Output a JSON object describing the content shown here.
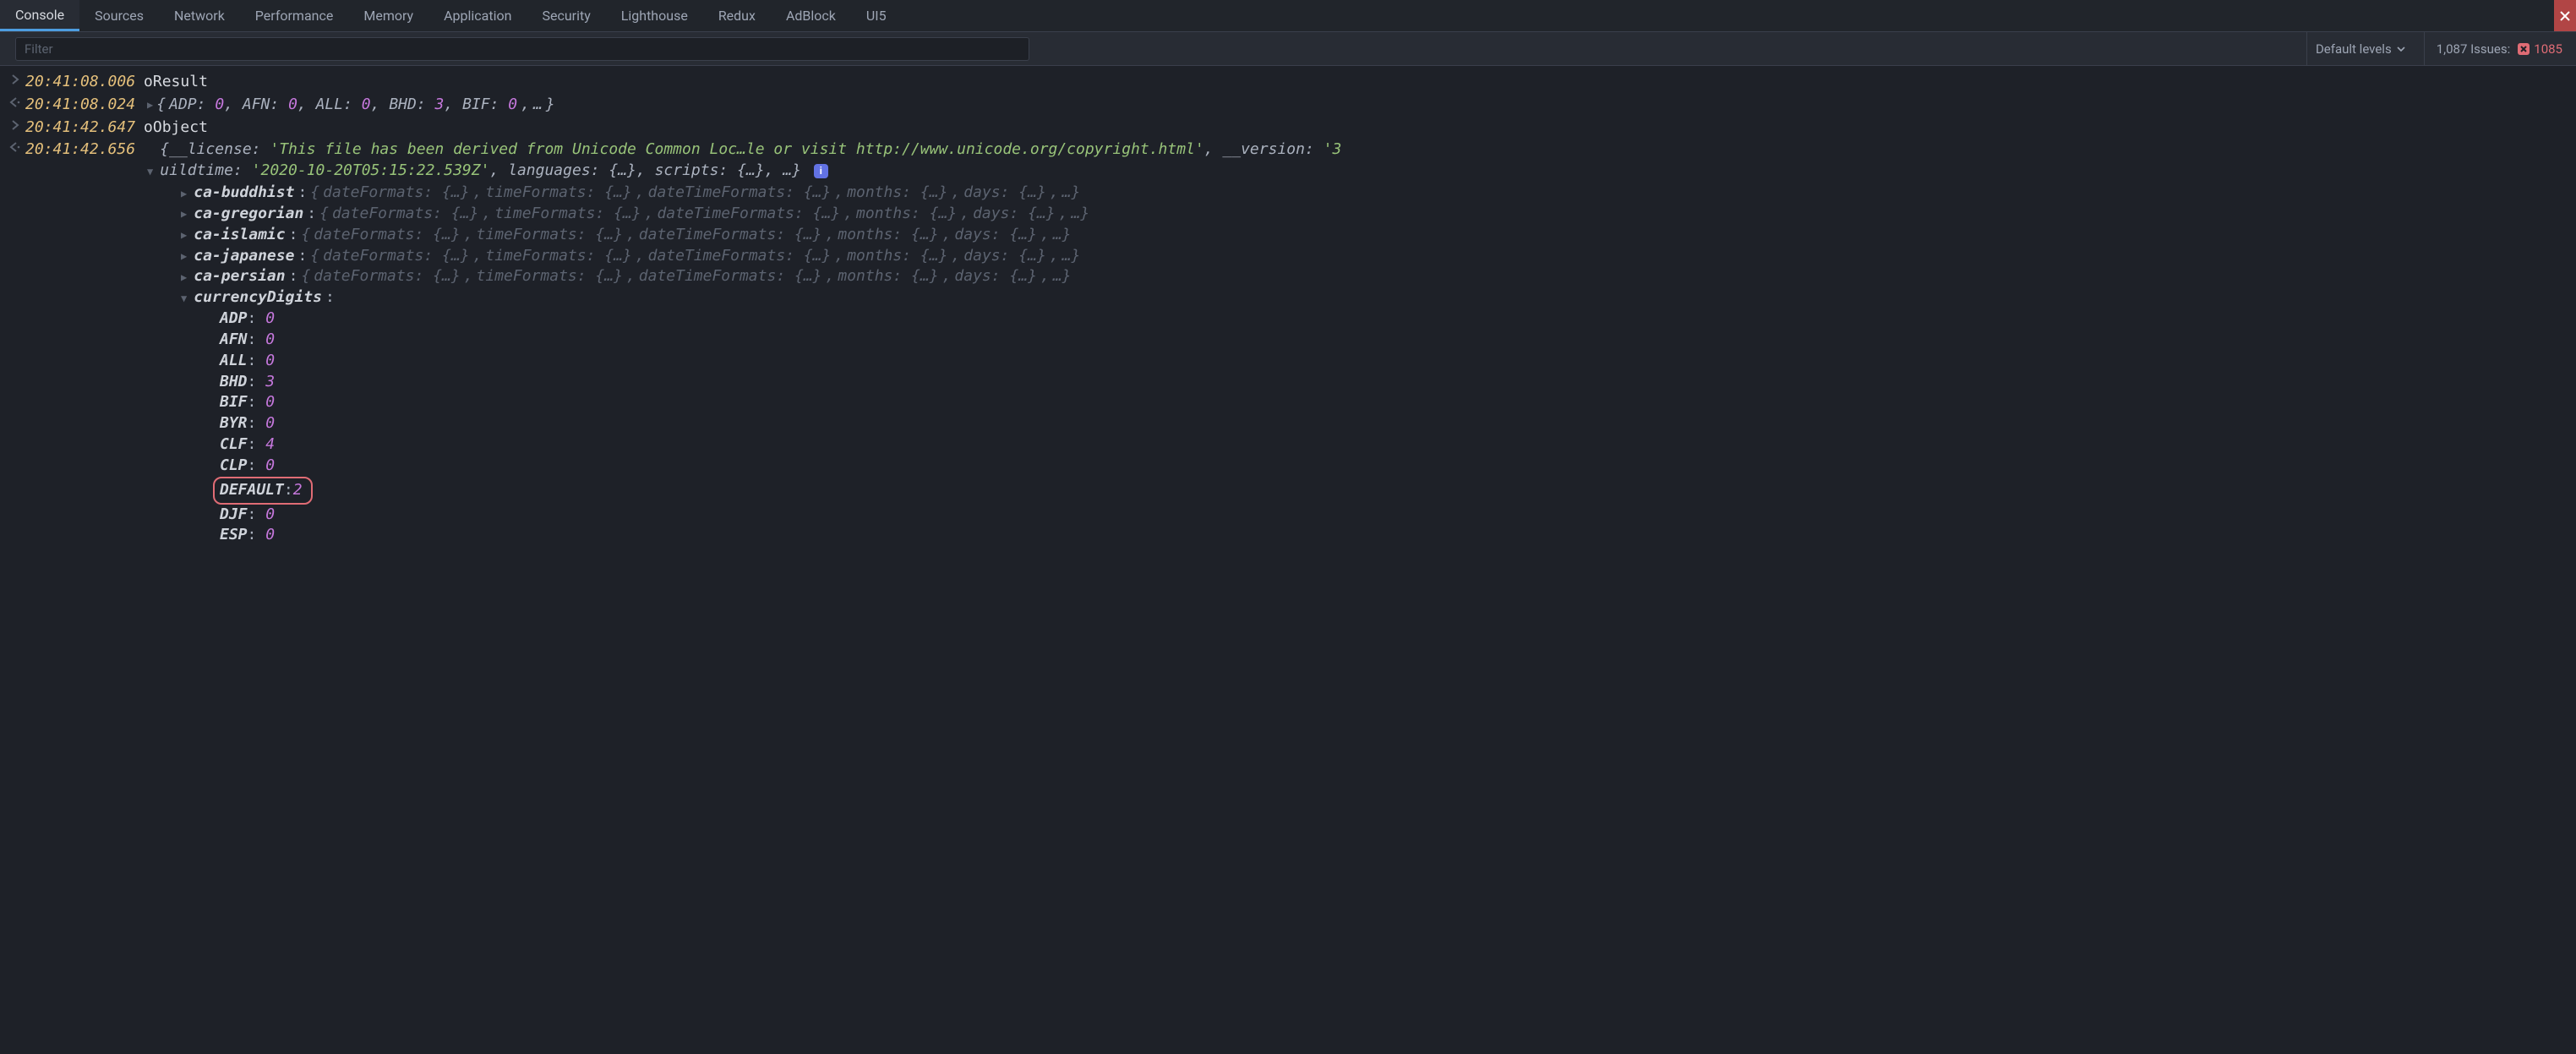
{
  "tabs": [
    "Console",
    "Sources",
    "Network",
    "Performance",
    "Memory",
    "Application",
    "Security",
    "Lighthouse",
    "Redux",
    "AdBlock",
    "UI5"
  ],
  "active_tab_index": 0,
  "filter": {
    "placeholder": "Filter"
  },
  "levels_label": "Default levels",
  "issues_label": "1,087 Issues:",
  "issues_error_count": "1085",
  "info_badge": "i",
  "rows": [
    {
      "dir": "in",
      "ts": "20:41:08.006",
      "ident": "oResult"
    },
    {
      "dir": "out",
      "ts": "20:41:08.024",
      "preview_pairs": [
        {
          "k": "ADP",
          "v": "0"
        },
        {
          "k": "AFN",
          "v": "0"
        },
        {
          "k": "ALL",
          "v": "0"
        },
        {
          "k": "BHD",
          "v": "3"
        },
        {
          "k": "BIF",
          "v": "0"
        }
      ],
      "preview_trailing": "…"
    },
    {
      "dir": "in",
      "ts": "20:41:42.647",
      "ident": "oObject"
    },
    {
      "dir": "out",
      "ts": "20:41:42.656",
      "expanded": true
    }
  ],
  "obj_preview": {
    "line1": {
      "license_key": "__license",
      "license_val": "'This file has been derived from Unicode Common Loc…le or visit http://www.unicode.org/copyright.html'",
      "version_key": "__version",
      "version_tail": "'3"
    },
    "line2": {
      "buildtime_tail_key": "uildtime",
      "buildtime_val": "'2020-10-20T05:15:22.539Z'",
      "languages_key": "languages",
      "scripts_key": "scripts"
    }
  },
  "calendars": [
    "ca-buddhist",
    "ca-gregorian",
    "ca-islamic",
    "ca-japanese",
    "ca-persian"
  ],
  "calendar_props": [
    "dateFormats",
    "timeFormats",
    "dateTimeFormats",
    "months",
    "days"
  ],
  "currency_section_label": "currencyDigits",
  "currency_digits": [
    {
      "k": "ADP",
      "v": "0"
    },
    {
      "k": "AFN",
      "v": "0"
    },
    {
      "k": "ALL",
      "v": "0"
    },
    {
      "k": "BHD",
      "v": "3"
    },
    {
      "k": "BIF",
      "v": "0"
    },
    {
      "k": "BYR",
      "v": "0"
    },
    {
      "k": "CLF",
      "v": "4"
    },
    {
      "k": "CLP",
      "v": "0"
    },
    {
      "k": "DEFAULT",
      "v": "2",
      "highlight": true
    },
    {
      "k": "DJF",
      "v": "0"
    },
    {
      "k": "ESP",
      "v": "0"
    }
  ]
}
